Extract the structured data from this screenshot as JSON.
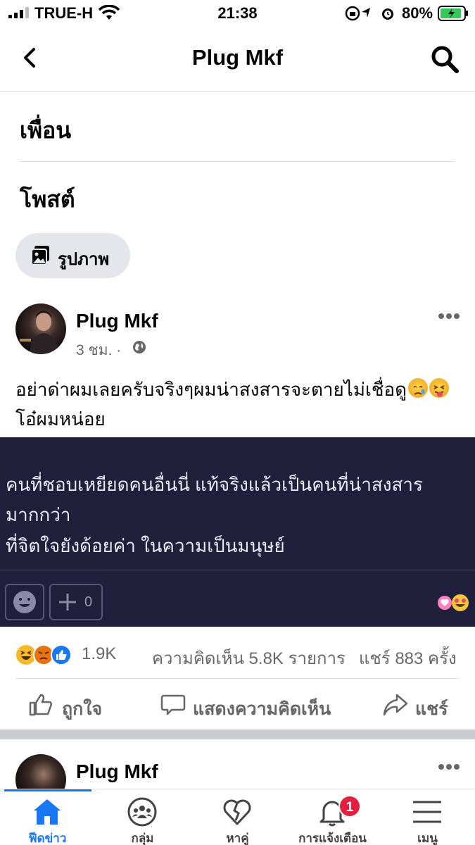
{
  "status_bar": {
    "carrier": "TRUE-H",
    "time": "21:38",
    "battery_percent": "80%"
  },
  "nav": {
    "title": "Plug Mkf"
  },
  "sections": {
    "friends": "เพื่อน",
    "posts": "โพสต์"
  },
  "filter_chip": {
    "label": "รูปภาพ"
  },
  "post": {
    "author": "Plug Mkf",
    "time": "3 ชม. ·",
    "text_line1": "อย่าด่าผมเลยครับจริงๆผมน่าสงสารจะตายไม่เชื่อดู",
    "text_line2": "โอ๋ผมหน่อย",
    "image_text": [
      "คนที่ชอบเหยียดคนอื่นนี่ แท้จริงแล้วเป็นคนที่น่าสงสาร",
      "มากกว่า",
      "ที่จิตใจยังด้อยค่า ในความเป็นมนุษย์"
    ],
    "image_add_count": "0",
    "reactions_count": "1.9K",
    "comments": "ความคิดเห็น 5.8K รายการ",
    "shares": "แชร์ 883 ครั้ง",
    "actions": {
      "like": "ถูกใจ",
      "comment": "แสดงความคิดเห็น",
      "share": "แชร์"
    }
  },
  "next_post": {
    "author": "Plug Mkf"
  },
  "tabbar": {
    "items": [
      {
        "label": "ฟีดข่าว",
        "icon": "home-icon",
        "active": true
      },
      {
        "label": "กลุ่ม",
        "icon": "groups-icon"
      },
      {
        "label": "หาคู่",
        "icon": "dating-heart-icon"
      },
      {
        "label": "การแจ้งเตือน",
        "icon": "bell-icon",
        "badge": "1"
      },
      {
        "label": "เมนู",
        "icon": "menu-icon"
      }
    ]
  },
  "colors": {
    "accent": "#1877f2",
    "badge": "#e41e3f",
    "image_bg": "#20203d"
  }
}
